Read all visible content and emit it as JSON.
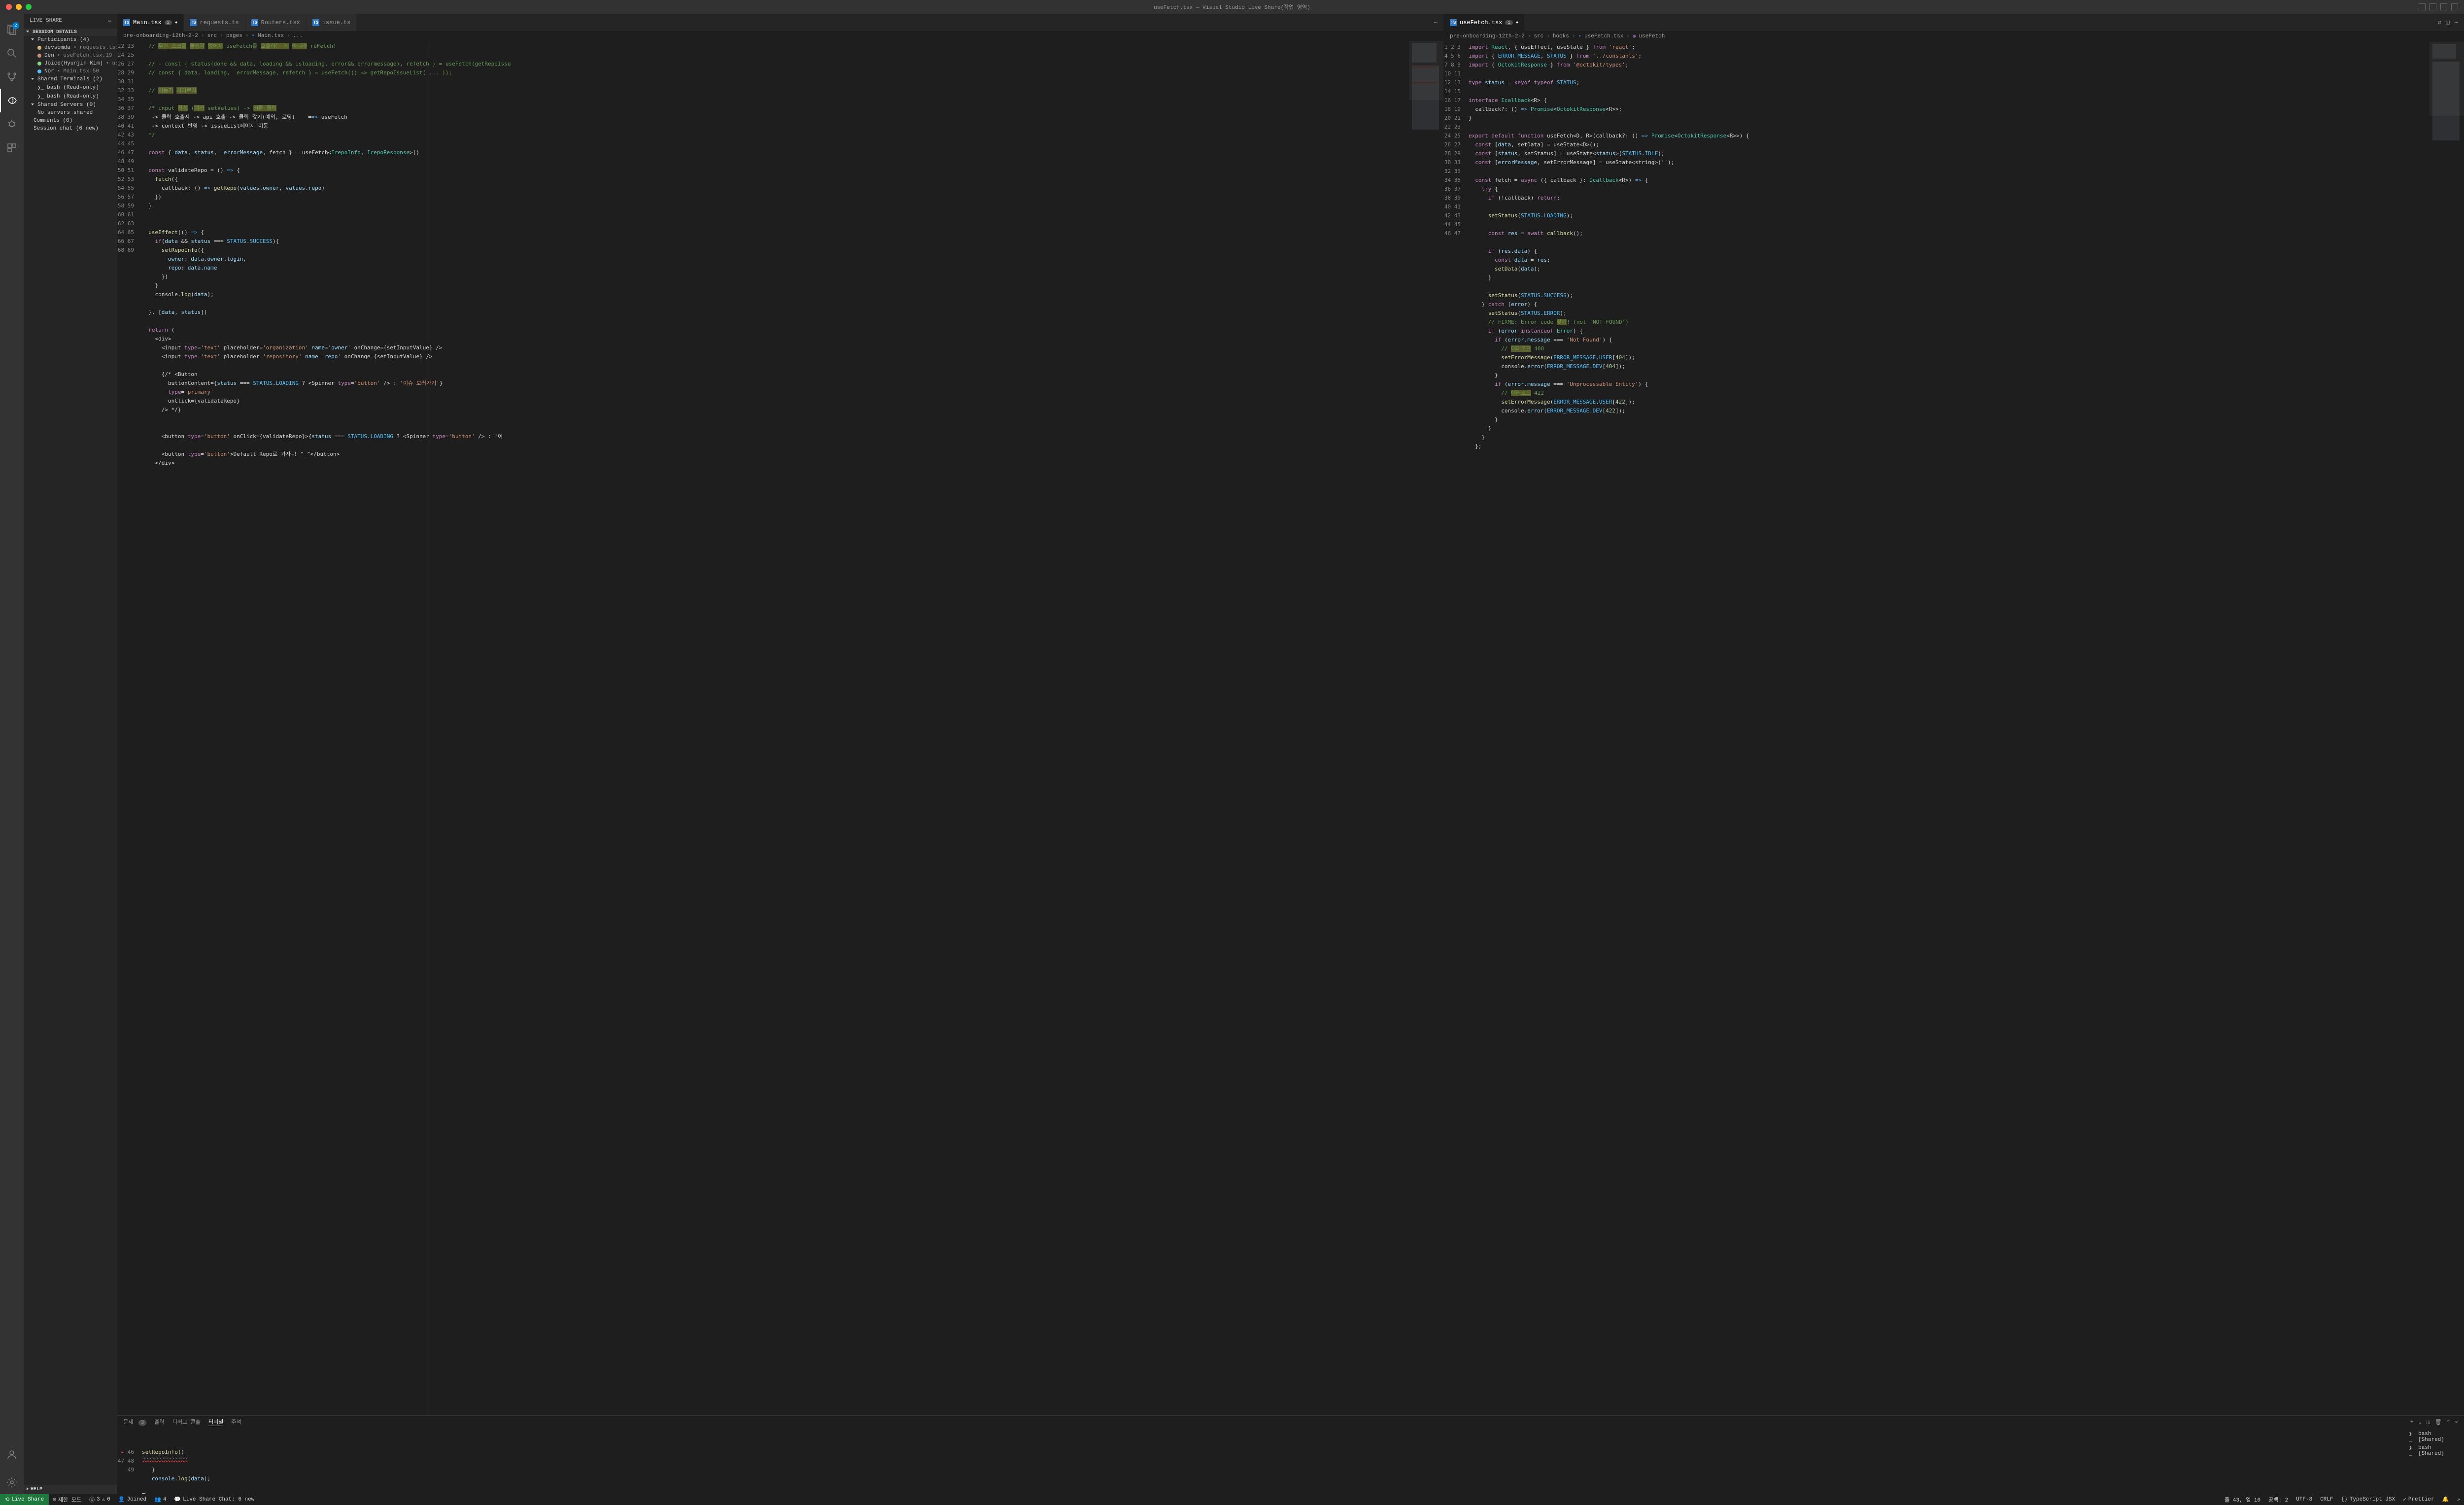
{
  "titlebar": {
    "title": "useFetch.tsx — Visual Studio Live Share(작업 영역)"
  },
  "sidebar": {
    "header": "LIVE SHARE",
    "session_details": "SESSION DETAILS",
    "participants_hdr": "Participants (4)",
    "participants": [
      {
        "name": "devsomda",
        "path": "requests.ts:3",
        "color": "yellow"
      },
      {
        "name": "Den",
        "path": "useFetch.tsx:19",
        "color": "orange"
      },
      {
        "name": "Joice(Hyunjin Kim)",
        "path": "useFetc...",
        "color": "green"
      },
      {
        "name": "Nor",
        "path": "Main.tsx:50",
        "color": "blue"
      }
    ],
    "shared_terminals": "Shared Terminals (2)",
    "terminals": [
      "bash (Read-only)",
      "bash (Read-only)"
    ],
    "shared_servers": "Shared Servers (0)",
    "no_servers": "No servers shared",
    "comments": "Comments (0)",
    "session_chat": "Session chat (6 new)",
    "help": "HELP"
  },
  "leftEditor": {
    "tabs": [
      "Main.tsx",
      "requests.ts",
      "Routers.tsx",
      "issue.ts"
    ],
    "activeTabCount": "2",
    "breadcrumb": [
      "pre-onboarding-12th-2-2",
      "src",
      "pages",
      "Main.tsx",
      "..."
    ],
    "gutterStart": 22,
    "gutterEnd": 68,
    "code": [
      "  // 무한 스크롤 쓸생각 없어서 useFetch를 호출하는 게 아니라 reFetch!",
      "",
      "  // - const { status(done && data, loading && isloading, error&& errormessage), refetch } = useFetch(getRepoIssu",
      "  // const { data, loading,  errorMessage, refetch } = useFetch(() => getRepoIssueList( ... ));",
      "",
      "  // 비동기 처리로직",
      "",
      "  /* input 작성 (여러 setValues) -> 버튼 클릭",
      "   -> 클릭 호출시 -> api 호출 -> 클릭 값기(예외, 로딩)    ==> useFetch",
      "   -> context 반영 -> issueList페이지 이동",
      "  */",
      "",
      "  const { data, status,  errorMessage, fetch } = useFetch<IrepoInfo, IrepoResponse>()",
      "",
      "  const validateRepo = () => {",
      "    fetch({",
      "      callback: () => getRepo(values.owner, values.repo)",
      "    })",
      "  }",
      "",
      "",
      "  useEffect(() => {",
      "    if(data && status === STATUS.SUCCESS){",
      "      setRepoInfo({",
      "        owner: data.owner.login,",
      "        repo: data.name",
      "      })",
      "    }",
      "    console.log(data);",
      "",
      "  }, [data, status])",
      "",
      "  return (",
      "    <div>",
      "      <input type='text' placeholder='organization' name='owner' onChange={setInputValue} />",
      "      <input type='text' placeholder='repository' name='repo' onChange={setInputValue} />",
      "",
      "      {/* <Button",
      "        buttonContent={status === STATUS.LOADING ? <Spinner type='button' /> : '이슈 보러가기'}",
      "        type='primary'",
      "        onClick={validateRepo}",
      "      /> */}",
      "",
      "",
      "      <button type='button' onClick={validateRepo}>{status === STATUS.LOADING ? <Spinner type='button' /> : '이",
      "",
      "      <button type='button'>Default Repo로 가자~! ^_^</button>",
      "    </div>"
    ]
  },
  "rightEditor": {
    "tabs": [
      "useFetch.tsx"
    ],
    "tabCount": "1",
    "breadcrumb": [
      "pre-onboarding-12th-2-2",
      "src",
      "hooks",
      "useFetch.tsx",
      "useFetch"
    ],
    "gutterStart": 1,
    "gutterEnd": 47,
    "code": [
      "import React, { useEffect, useState } from 'react';",
      "import { ERROR_MESSAGE, STATUS } from '../constants';",
      "import { OctokitResponse } from '@octokit/types';",
      "",
      "type status = keyof typeof STATUS;",
      "",
      "interface Icallback<R> {",
      "  callback?: () => Promise<OctokitResponse<R>>;",
      "}",
      "",
      "export default function useFetch<D, R>(callback?: () => Promise<OctokitResponse<R>>) {",
      "  const [data, setData] = useState<D>();",
      "  const [status, setStatus] = useState<status>(STATUS.IDLE);",
      "  const [errorMessage, setErrorMessage] = useState<string>('');",
      "",
      "  const fetch = async ({ callback }: Icallback<R>) => {",
      "    try {",
      "      if (!callback) return;",
      "",
      "      setStatus(STATUS.LOADING);",
      "",
      "      const res = await callback();",
      "",
      "      if (res.data) {",
      "        const data = res;",
      "        setData(data);",
      "      }",
      "",
      "      setStatus(STATUS.SUCCESS);",
      "    } catch (error) {",
      "      setStatus(STATUS.ERROR);",
      "      // FIXME: Error code 찾기! (not 'NOT FOUND')",
      "      if (error instanceof Error) {",
      "        if (error.message === 'Not Found') {",
      "          // 에러코드 400",
      "          setErrorMessage(ERROR_MESSAGE.USER[404]);",
      "          console.error(ERROR_MESSAGE.DEV[404]);",
      "        }",
      "        if (error.message === 'Unprocessable Entity') {",
      "          // 에러코드 422",
      "          setErrorMessage(ERROR_MESSAGE.USER[422]);",
      "          console.error(ERROR_MESSAGE.DEV[422]);",
      "        }",
      "      }",
      "    }",
      "  };",
      ""
    ]
  },
  "panel": {
    "tabs": [
      "문제",
      "출력",
      "디버그 콘솔",
      "터미널",
      "주석"
    ],
    "problemCount": "3",
    "snippet": [
      "      setRepoInfo()",
      "   }",
      "   console.log(data);",
      ""
    ],
    "snippetGutter": [
      "46",
      "47",
      "48",
      "49"
    ],
    "terminals": [
      "bash [Shared]",
      "bash [Shared]"
    ]
  },
  "statusbar": {
    "liveshare": "Live Share",
    "limited": "제한 모드",
    "problems_err": "3",
    "problems_warn": "0",
    "joined": "Joined",
    "joinedCount": "4",
    "chat": "Live Share Chat: 6 new",
    "cursor": "줄 43, 열 10",
    "spaces": "공백: 2",
    "encoding": "UTF-8",
    "eol": "CRLF",
    "lang": "TypeScript JSX",
    "prettier": "Prettier"
  }
}
